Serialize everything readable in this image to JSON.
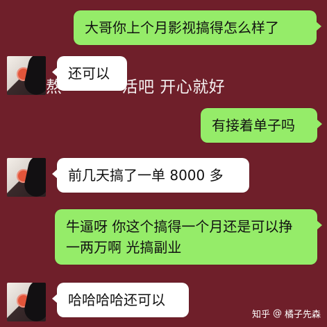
{
  "conversation": {
    "messages": [
      {
        "direction": "out",
        "text": "大哥你上个月影视搞得怎么样了"
      },
      {
        "direction": "in",
        "text": "还可以"
      },
      {
        "direction": "out",
        "text": "有接着单子吗"
      },
      {
        "direction": "in",
        "text": "前几天搞了一单 8000 多"
      },
      {
        "direction": "out",
        "text": "牛逼呀 你这个搞得一个月还是可以挣一两万啊 光搞副业"
      },
      {
        "direction": "in",
        "text": "哈哈哈哈还可以"
      }
    ],
    "background_text": {
      "left_partial": "熬",
      "right_partial": "活吧 开心就好"
    }
  },
  "watermark": {
    "site": "知乎",
    "separator": "@",
    "author": "橘子先森"
  },
  "colors": {
    "background": "#6f1f2a",
    "bubble_out": "#95ec69",
    "bubble_in": "#ffffff"
  }
}
